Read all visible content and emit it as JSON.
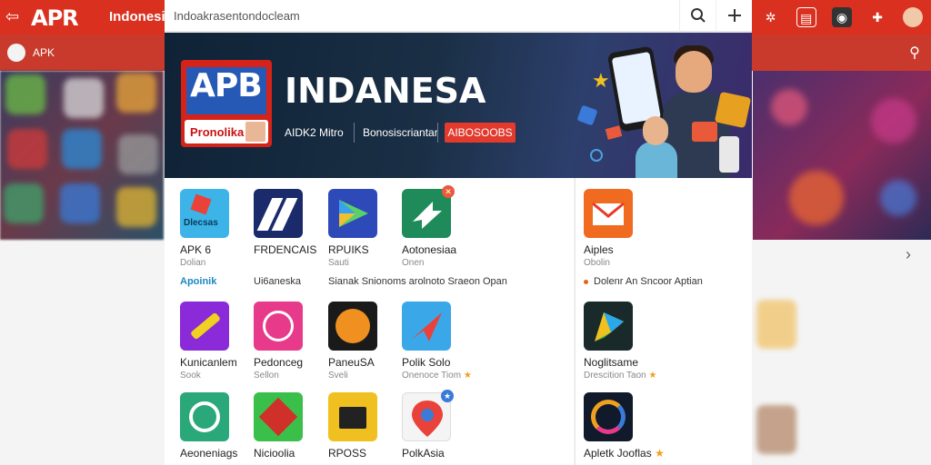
{
  "topbar": {
    "logo": "APR",
    "title": "Indonesia"
  },
  "secondbar": {
    "label": "APK"
  },
  "search": {
    "value": "Indoakrasentondocleam"
  },
  "banner": {
    "logo_text": "APB",
    "logo_sub": "Pronolika",
    "title": "INDANESA",
    "sub1": "AIDK2 Mitro",
    "sub2": "Bonosiscriantar",
    "cta": "AIBOSOOBS"
  },
  "apps_row1": [
    {
      "name": "APK 6",
      "sub": "Dolian"
    },
    {
      "name": "FRDENCAIS",
      "sub": ""
    },
    {
      "name": "RPUIKS",
      "sub": "Sauti"
    },
    {
      "name": "Aotonesiaa",
      "sub": "Onen"
    }
  ],
  "row1_links": {
    "accent": "Apoinik",
    "text1": "Ui6aneska",
    "text2": "Sianak Snionoms arolnoto Sraeon Opan"
  },
  "apps_row2": [
    {
      "name": "Kunicanlem",
      "sub": "Sook"
    },
    {
      "name": "Pedonceg",
      "sub": "Sellon"
    },
    {
      "name": "PaneuSA",
      "sub": "Sveli"
    },
    {
      "name": "Polik Solo",
      "sub": "Onenoce Tiom",
      "star": "★"
    }
  ],
  "apps_row3": [
    {
      "name": "Aeoneniags",
      "sub": ""
    },
    {
      "name": "Nicioolia",
      "sub": ""
    },
    {
      "name": "RPOSS",
      "sub": ""
    },
    {
      "name": "PolkAsia",
      "sub": ""
    }
  ],
  "right_apps": [
    {
      "name": "Aiples",
      "sub": "Obolin"
    },
    {
      "name": "Noglitsame",
      "sub": "Drescition Taon",
      "star": "★"
    },
    {
      "name": "Apletk Jooflas",
      "sub": "",
      "star": "★"
    }
  ],
  "right_link": "Dolenr An Sncoor Aptian",
  "colors": {
    "brand_red": "#d9301f",
    "banner_bg": "#0f2236",
    "accent_blue": "#1a8ac0",
    "star": "#f0a020"
  }
}
